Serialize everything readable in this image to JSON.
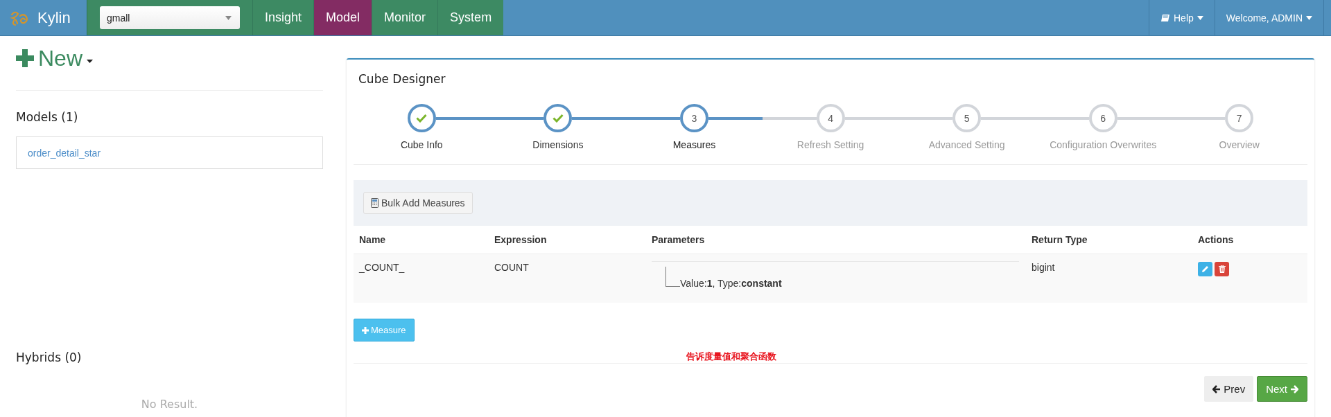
{
  "app": {
    "name": "Kylin"
  },
  "project_select": {
    "value": "gmall"
  },
  "nav_tabs": [
    {
      "label": "Insight",
      "selected": false
    },
    {
      "label": "Model",
      "selected": true
    },
    {
      "label": "Monitor",
      "selected": false
    },
    {
      "label": "System",
      "selected": false
    }
  ],
  "user_menu": {
    "help": "Help",
    "welcome": "Welcome, ADMIN"
  },
  "sidebar": {
    "new_label": "New",
    "models_title": "Models (1)",
    "models": [
      {
        "name": "order_detail_star"
      }
    ],
    "hybrids_title": "Hybrids (0)",
    "hybrids_empty": "No Result."
  },
  "designer": {
    "title": "Cube Designer",
    "steps": [
      {
        "label": "Cube Info",
        "completed": true,
        "current": false
      },
      {
        "label": "Dimensions",
        "completed": true,
        "current": false
      },
      {
        "number": "3",
        "label": "Measures",
        "completed": false,
        "current": true
      },
      {
        "number": "4",
        "label": "Refresh Setting",
        "completed": false,
        "current": false
      },
      {
        "number": "5",
        "label": "Advanced Setting",
        "completed": false,
        "current": false
      },
      {
        "number": "6",
        "label": "Configuration Overwrites",
        "completed": false,
        "current": false
      },
      {
        "number": "7",
        "label": "Overview",
        "completed": false,
        "current": false
      }
    ],
    "bulk_button": "Bulk Add Measures",
    "columns": [
      "Name",
      "Expression",
      "Parameters",
      "Return Type",
      "Actions"
    ],
    "rows": [
      {
        "name": "_COUNT_",
        "expression": "COUNT",
        "parameters": "Value:**1**, Type:**constant**",
        "return_type": "bigint"
      }
    ],
    "add_button": "Measure",
    "annotation": "告诉度量值和聚合函数",
    "prev": "Prev",
    "next": "Next"
  }
}
